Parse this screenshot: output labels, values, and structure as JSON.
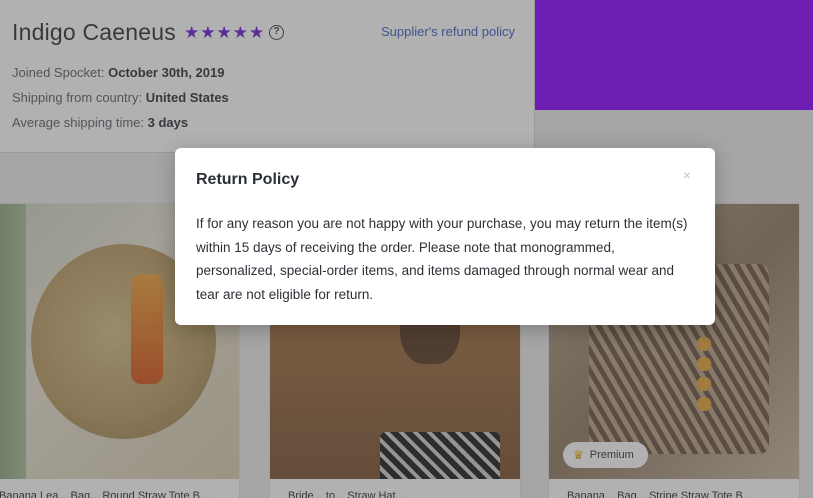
{
  "supplier": {
    "name": "Indigo Caeneus",
    "stars": "★★★★★",
    "help_icon": "?",
    "refund_link": "Supplier's refund policy",
    "joined_label": "Joined Spocket:",
    "joined_value": "October 30th, 2019",
    "shipping_label": "Shipping from country:",
    "shipping_value": "United States",
    "avg_label": "Average shipping time:",
    "avg_value": "3 days"
  },
  "products": [
    {
      "title": "Banana Lea... Bag... Round Straw Tote B...",
      "image": "round-straw-bag"
    },
    {
      "title": "Bride... to... Straw Hat...",
      "image": "woman-with-clutch"
    },
    {
      "title": "Banana... Bag... Stripe Straw Tote B...",
      "image": "straw-tote-bag",
      "badge": "Premium",
      "badge_icon": "crown-icon"
    }
  ],
  "modal": {
    "title": "Return Policy",
    "close_icon": "×",
    "body": "If for any reason you are not happy with your purchase, you may return the item(s) within 15 days of receiving the order. Please note that monogrammed, personalized, special-order items, and items damaged through normal wear and tear are not eligible for return."
  },
  "colors": {
    "accent_purple": "#8a00ff",
    "star_color": "#6a1fd6",
    "link_blue": "#3b5fc5",
    "premium_crown": "#e6a21a"
  }
}
